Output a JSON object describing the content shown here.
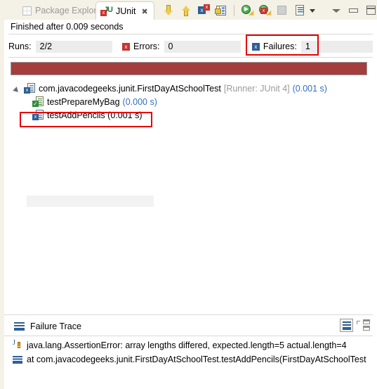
{
  "window": {
    "tabs": [
      {
        "label": "Package Explorer",
        "icon": "package-explorer-icon",
        "active": false,
        "closable": false
      },
      {
        "label": "JUnit",
        "icon": "junit-icon",
        "active": true,
        "closable": true,
        "close_glyph": "✖"
      }
    ]
  },
  "toolbar": {
    "items": [
      {
        "name": "next-failure-button",
        "tooltip": "Next Failed Test",
        "icon": "arrow-down-icon"
      },
      {
        "name": "previous-failure-button",
        "tooltip": "Previous Failed Test",
        "icon": "arrow-up-icon"
      },
      {
        "name": "show-failures-only-button",
        "tooltip": "Show Failures Only",
        "icon": "failures-only-icon",
        "glyph": "x",
        "badge_glyph": "x"
      },
      {
        "name": "lock-scroll-button",
        "tooltip": "Scroll Lock",
        "icon": "lock-icon"
      },
      {
        "name": "rerun-test-button",
        "tooltip": "Rerun Test",
        "icon": "rerun-icon"
      },
      {
        "name": "rerun-failed-button",
        "tooltip": "Rerun Test - Failures First",
        "icon": "rerun-failed-icon",
        "glyph": "x"
      },
      {
        "name": "stop-button",
        "tooltip": "Stop JUnit Test Run",
        "icon": "stop-icon"
      },
      {
        "name": "test-history-button",
        "tooltip": "Test Run History",
        "icon": "history-list-icon"
      },
      {
        "name": "history-dropdown-button",
        "tooltip": "Test Run History Menu",
        "icon": "chevron-down-icon"
      },
      {
        "name": "view-menu-button",
        "tooltip": "View Menu",
        "icon": "view-menu-icon"
      },
      {
        "name": "minimize-button",
        "tooltip": "Minimize",
        "icon": "minimize-icon"
      },
      {
        "name": "maximize-button",
        "tooltip": "Maximize",
        "icon": "maximize-icon"
      }
    ]
  },
  "status": {
    "text": "Finished after 0.009 seconds"
  },
  "counters": {
    "runs_label": "Runs:",
    "runs_value": "2/2",
    "errors_label": "Errors:",
    "errors_value": "0",
    "errors_icon": "error-x-icon",
    "errors_icon_glyph": "x",
    "failures_label": "Failures:",
    "failures_value": "1",
    "failures_icon": "failure-x-icon",
    "failures_icon_glyph": "x"
  },
  "progress": {
    "percent": 100,
    "state": "failed",
    "color": "#a43e3e"
  },
  "tree": {
    "nodes": [
      {
        "name": "com.javacodegeeks.junit.FirstDayAtSchoolTest",
        "runner": "[Runner: JUnit 4]",
        "time": "(0.001 s)",
        "status": "failed",
        "expanded": true,
        "icon": "test-class-failed-icon",
        "badge_glyph": "x"
      },
      {
        "name": "testPrepareMyBag",
        "runner": "",
        "time": "(0.000 s)",
        "status": "passed",
        "icon": "test-passed-icon",
        "badge_glyph": "✓"
      },
      {
        "name": "testAddPencils (0.001 s)",
        "runner": "",
        "time": "",
        "status": "failed",
        "selected": true,
        "icon": "test-failed-icon",
        "badge_glyph": "x"
      }
    ]
  },
  "failure_trace": {
    "title": "Failure Trace",
    "icon": "failure-trace-icon",
    "tools": [
      {
        "name": "filter-stack-trace-button",
        "tooltip": "Filter Stack Trace",
        "icon": "filter-icon",
        "pressed": true
      },
      {
        "name": "maximize-trace-button",
        "tooltip": "Maximize",
        "icon": "restore-panels-icon",
        "pressed": false
      }
    ],
    "rows": [
      {
        "icon": "exception-icon",
        "text": "java.lang.AssertionError: array lengths differed, expected.length=5 actual.length=4"
      },
      {
        "icon": "stack-frame-icon",
        "text": "at com.javacodegeeks.junit.FirstDayAtSchoolTest.testAddPencils(FirstDayAtSchoolTest"
      }
    ]
  },
  "annotations": {
    "failures_highlight_color": "#e60000",
    "selected_test_highlight_color": "#e60000"
  }
}
